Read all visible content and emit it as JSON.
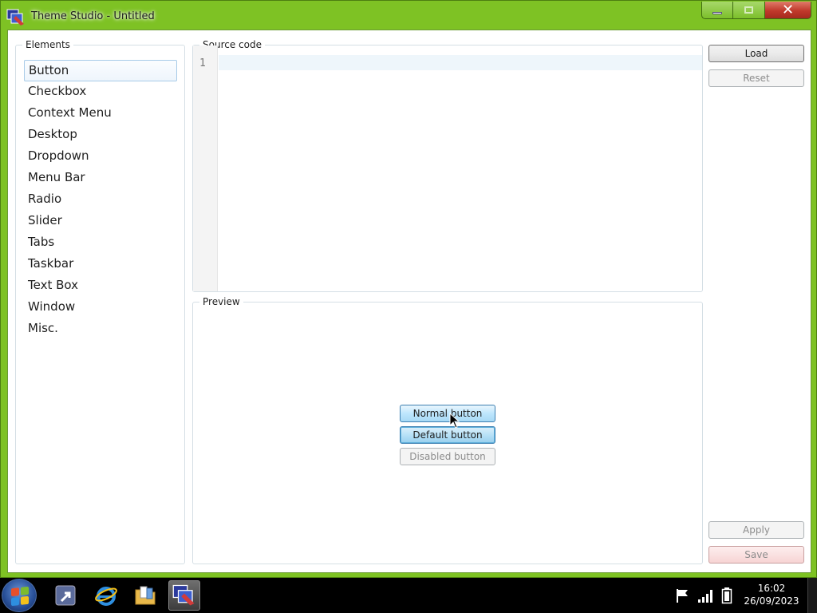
{
  "window": {
    "title": "Theme Studio - Untitled",
    "close_symbol": "✕"
  },
  "elements": {
    "label": "Elements",
    "items": [
      "Button",
      "Checkbox",
      "Context Menu",
      "Desktop",
      "Dropdown",
      "Menu Bar",
      "Radio",
      "Slider",
      "Tabs",
      "Taskbar",
      "Text Box",
      "Window",
      "Misc."
    ],
    "selected": "Button"
  },
  "source": {
    "label": "Source code",
    "line_number": "1"
  },
  "preview": {
    "label": "Preview",
    "normal_button": "Normal button",
    "default_button": "Default button",
    "disabled_button": "Disabled button"
  },
  "actions": {
    "load": "Load",
    "reset": "Reset",
    "apply": "Apply",
    "save": "Save"
  },
  "taskbar": {
    "time": "16:02",
    "date": "26/09/2023",
    "icons": [
      "start-orb-icon",
      "shortcut-icon",
      "internet-explorer-icon",
      "folder-icon",
      "theme-studio-icon"
    ]
  },
  "colors": {
    "frame": "#7ec224",
    "accent_button": "#bee6fd",
    "close": "#c0392b"
  }
}
